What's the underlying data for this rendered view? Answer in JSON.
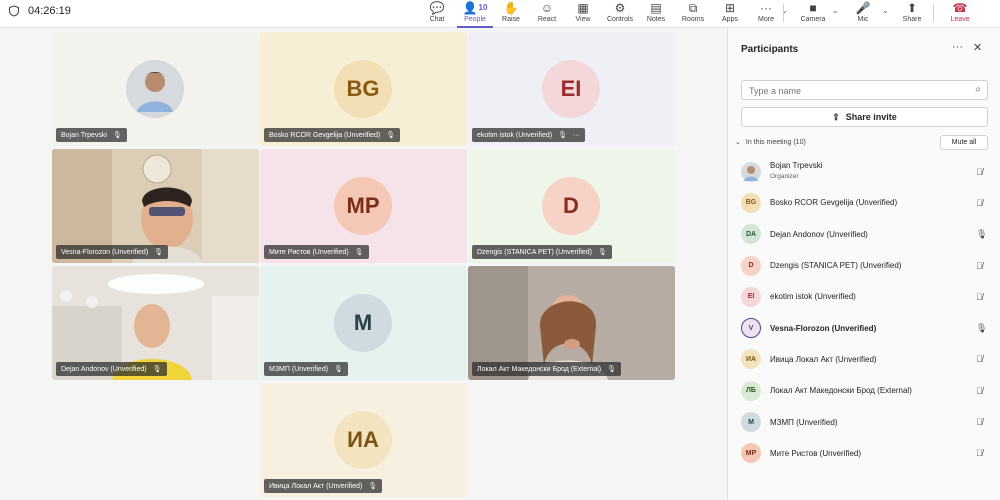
{
  "topbar": {
    "timer": "04:26:19",
    "items": [
      {
        "label": "Chat",
        "icon": "chat-icon",
        "glyph": "💬"
      },
      {
        "label": "People",
        "icon": "people-icon",
        "glyph": "👤",
        "badge": "10"
      },
      {
        "label": "Raise",
        "icon": "raise-hand-icon",
        "glyph": "✋"
      },
      {
        "label": "React",
        "icon": "react-icon",
        "glyph": "☺"
      },
      {
        "label": "View",
        "icon": "view-icon",
        "glyph": "▦"
      },
      {
        "label": "Controls",
        "icon": "controls-icon",
        "glyph": "⚙"
      },
      {
        "label": "Notes",
        "icon": "notes-icon",
        "glyph": "▤"
      },
      {
        "label": "Rooms",
        "icon": "rooms-icon",
        "glyph": "⧉"
      },
      {
        "label": "Apps",
        "icon": "apps-icon",
        "glyph": "⊞"
      },
      {
        "label": "More",
        "icon": "more-icon",
        "glyph": "···"
      },
      {
        "label": "Camera",
        "icon": "camera-icon",
        "glyph": "■"
      },
      {
        "label": "Mic",
        "icon": "mic-off-icon",
        "glyph": "🎤"
      },
      {
        "label": "Share",
        "icon": "share-icon",
        "glyph": "⬆"
      },
      {
        "label": "Leave",
        "icon": "leave-call-icon",
        "glyph": "☎"
      }
    ]
  },
  "tiles": [
    {
      "name": "Bojan Trpevski",
      "kind": "photo",
      "bg": "#f3f3ee"
    },
    {
      "name": "Bosko RCOR Gevgelija (Unverified)",
      "kind": "initials",
      "initials": "BG",
      "bg": "#f6efd6",
      "circle": "#f3dfb6",
      "fg": "#8a5a12"
    },
    {
      "name": "ekotim istok (Unverified)",
      "kind": "initials",
      "initials": "EI",
      "bg": "#eef0f5",
      "circle": "#f4d7d9",
      "fg": "#9a2b2f",
      "more": "···"
    },
    {
      "name": "Vesna-Florozon (Unverified)",
      "kind": "video",
      "bg": "#dccdb6"
    },
    {
      "name": "Мите Ристов (Unverified)",
      "kind": "initials",
      "initials": "MP",
      "bg": "#f6e3ea",
      "circle": "#f5c8b6",
      "fg": "#7b2d18"
    },
    {
      "name": "Dzengis (STANICA PET) (Unverified)",
      "kind": "initials",
      "initials": "D",
      "bg": "#eef5e9",
      "circle": "#f6d2c7",
      "fg": "#8a2f1e"
    },
    {
      "name": "Dejan Andonov (Unverified)",
      "kind": "video",
      "bg": "#e7e3dc"
    },
    {
      "name": "МЗМП (Unverified)",
      "kind": "initials",
      "initials": "M",
      "bg": "#e6f2ee",
      "circle": "#cfdbe0",
      "fg": "#2c3e46"
    },
    {
      "name": "Локал Акт Македонски Брод (External)",
      "kind": "video",
      "bg": "#b6aca4"
    },
    {
      "name": "Ивица Локал Акт (Unverified)",
      "kind": "initials",
      "initials": "ИА",
      "bg": "#f7efe0",
      "circle": "#f4e3bf",
      "fg": "#7a5412"
    }
  ],
  "panel": {
    "title": "Participants",
    "more": "···",
    "close": "✕",
    "search_placeholder": "Type a name",
    "share_invite": "Share invite",
    "in_meeting": "In this meeting (10)",
    "mute_all": "Mute all",
    "participants": [
      {
        "name": "Bojan Trpevski",
        "sub": "Organizer",
        "initials": "",
        "photo": true,
        "mic": "off"
      },
      {
        "name": "Bosko RCOR Gevgelija (Unverified)",
        "initials": "BG",
        "bg": "#f3dfb6",
        "fg": "#8a5a12",
        "mic": "off"
      },
      {
        "name": "Dejan Andonov (Unverified)",
        "initials": "DA",
        "bg": "#d3e6d8",
        "fg": "#1f5a33",
        "mic": "on"
      },
      {
        "name": "Dzengis (STANICA PET) (Unverified)",
        "initials": "D",
        "bg": "#f6d2c7",
        "fg": "#8a2f1e",
        "mic": "off"
      },
      {
        "name": "ekotim istok (Unverified)",
        "initials": "EI",
        "bg": "#f4d7d9",
        "fg": "#9a2b2f",
        "mic": "off"
      },
      {
        "name": "Vesna-Florozon (Unverified)",
        "initials": "V",
        "bg": "#e9e3f2",
        "fg": "#5b3f86",
        "mic": "on",
        "bold": true
      },
      {
        "name": "Ивица Локал Акт (Unverified)",
        "initials": "ИА",
        "bg": "#f4e3bf",
        "fg": "#7a5412",
        "mic": "off"
      },
      {
        "name": "Локал Акт Македонски Брод (External)",
        "initials": "ЛБ",
        "bg": "#d8ecd4",
        "fg": "#2e5b23",
        "mic": "off"
      },
      {
        "name": "МЗМП (Unverified)",
        "initials": "M",
        "bg": "#cfdbe0",
        "fg": "#2c3e46",
        "mic": "off"
      },
      {
        "name": "Мите Ристов (Unverified)",
        "initials": "MP",
        "bg": "#f5c8b6",
        "fg": "#7b2d18",
        "mic": "off"
      }
    ]
  }
}
